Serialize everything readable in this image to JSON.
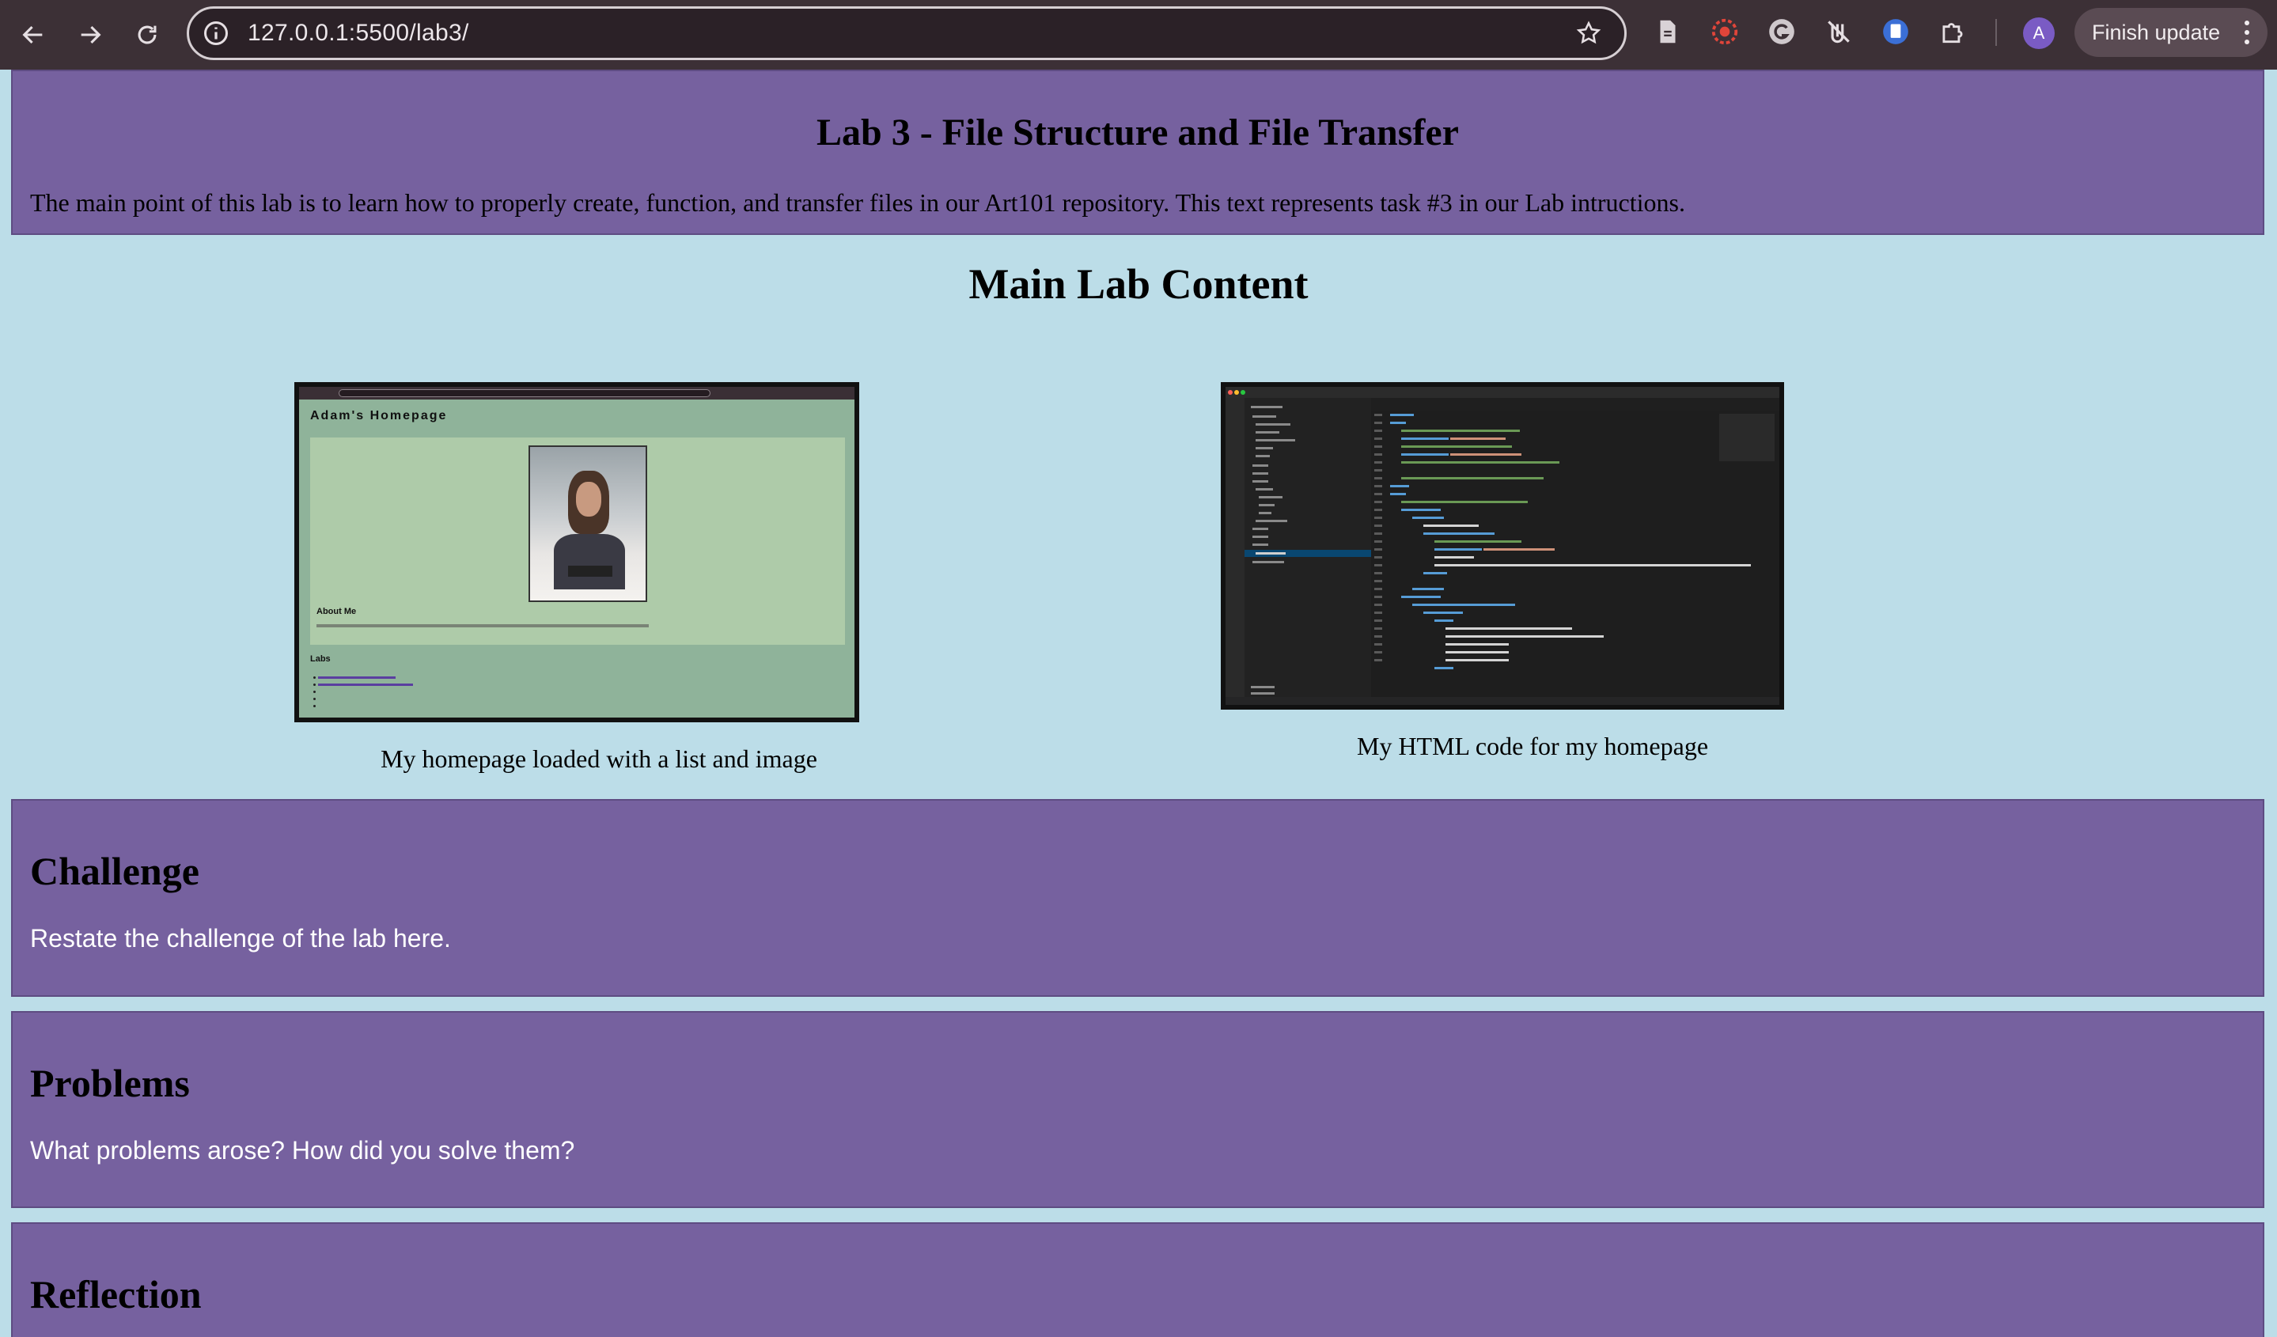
{
  "browser": {
    "url": "127.0.0.1:5500/lab3/",
    "profile_initial": "A",
    "update_button": "Finish update",
    "icons": [
      "back-icon",
      "forward-icon",
      "reload-icon",
      "site-info-icon",
      "bookmark-star-icon",
      "document-icon",
      "extension-red-icon",
      "grammarly-icon",
      "extension-slash-icon",
      "extension-blue-icon",
      "extensions-puzzle-icon",
      "menu-dots-icon"
    ]
  },
  "header": {
    "title": "Lab 3 - File Structure and File Transfer",
    "description": "The main point of this lab is to learn how to properly create, function, and transfer files in our Art101 repository. This text represents task #3 in our Lab intructions."
  },
  "main": {
    "title": "Main Lab Content",
    "figures": [
      {
        "caption": "My homepage loaded with a list and image",
        "screenshot": {
          "page_name": "Adam's Homepage",
          "about_heading": "About Me",
          "about_text": "Hi! I'm Adam, and I am an undergrad at UCSC finishing my fourth year as a History/Global and Community Health double major!",
          "labs_heading": "Labs",
          "labs": [
            "Lab 1: HTML and CSS Startup",
            "Lab 2: File Structure and File Transfer"
          ]
        }
      },
      {
        "caption": "My HTML code for my homepage"
      }
    ]
  },
  "sections": {
    "challenge": {
      "heading": "Challenge",
      "body": "Restate the challenge of the lab here."
    },
    "problems": {
      "heading": "Problems",
      "body": "What problems arose? How did you solve them?"
    },
    "reflection": {
      "heading": "Reflection"
    }
  },
  "colors": {
    "page_background": "#bcdde8",
    "section_background": "#76619f",
    "chrome_background": "#3c3036"
  }
}
